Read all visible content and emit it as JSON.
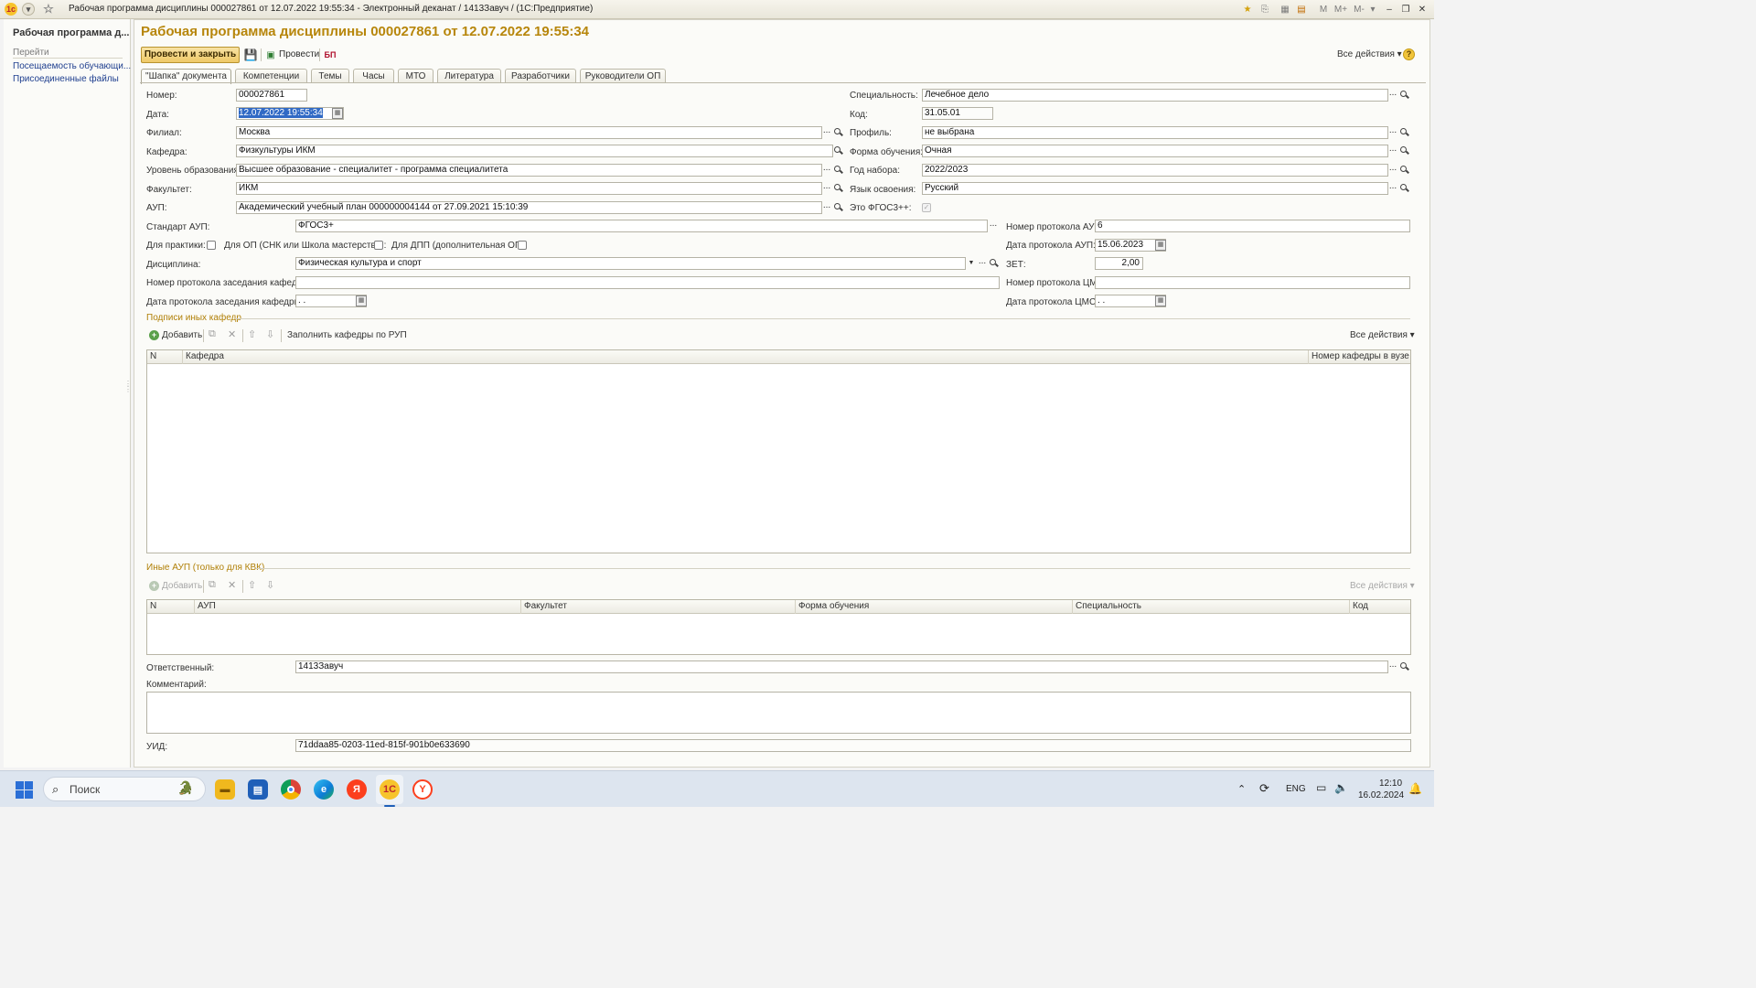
{
  "window": {
    "title": "Рабочая программа дисциплины 000027861 от 12.07.2022 19:55:34 - Электронный деканат / 1413Завуч /   (1С:Предприятие)",
    "tr_m": "M",
    "tr_mplus": "M+",
    "tr_mminus": "M-"
  },
  "left_panel": {
    "title": "Рабочая программа д...",
    "section": "Перейти",
    "links": [
      "Посещаемость обучающи...",
      "Присоединенные файлы"
    ]
  },
  "doc": {
    "title": "Рабочая программа дисциплины 000027861 от 12.07.2022 19:55:34",
    "toolbar": {
      "post_close": "Провести и закрыть",
      "post": "Провести",
      "bp_icon": "БП",
      "all_actions": "Все действия"
    },
    "tabs": [
      "\"Шапка\" документа",
      "Компетенции",
      "Темы",
      "Часы",
      "МТО",
      "Литература",
      "Разработчики",
      "Руководители ОП"
    ]
  },
  "form": {
    "number": {
      "label": "Номер:",
      "value": "000027861"
    },
    "date": {
      "label": "Дата:",
      "value": "12.07.2022 19:55:34"
    },
    "branch": {
      "label": "Филиал:",
      "value": "Москва"
    },
    "department": {
      "label": "Кафедра:",
      "value": "Физкультуры ИКМ"
    },
    "edu_level": {
      "label": "Уровень образования:",
      "value": "Высшее образование - специалитет - программа специалитета"
    },
    "faculty": {
      "label": "Факультет:",
      "value": "ИКМ"
    },
    "aup": {
      "label": "АУП:",
      "value": "Академический учебный план 000000004144 от 27.09.2021 15:10:39"
    },
    "specialty": {
      "label": "Специальность:",
      "value": "Лечебное дело"
    },
    "code": {
      "label": "Код:",
      "value": "31.05.01"
    },
    "profile": {
      "label": "Профиль:",
      "value": "не выбрана"
    },
    "study_form": {
      "label": "Форма обучения:",
      "value": "Очная"
    },
    "enroll_year": {
      "label": "Год набора:",
      "value": "2022/2023"
    },
    "language": {
      "label": "Язык освоения:",
      "value": "Русский"
    },
    "fgos": {
      "label": "Это ФГОС3++:"
    },
    "aup_standard": {
      "label": "Стандарт АУП:",
      "value": "ФГОС3+"
    },
    "aup_protocol_num": {
      "label": "Номер протокола АУП:",
      "value": "6"
    },
    "for_practice": {
      "label": "Для практики:"
    },
    "for_op": {
      "label": "Для ОП (СНК или Школа мастерства):"
    },
    "for_dpp": {
      "label": "Для ДПП (дополнительная ОП):"
    },
    "aup_protocol_date": {
      "label": "Дата протокола АУП:",
      "value": "15.06.2023"
    },
    "discipline": {
      "label": "Дисциплина:",
      "value": "Физическая культура и спорт"
    },
    "zet": {
      "label": "ЗЕТ:",
      "value": "2,00"
    },
    "dept_protocol_num": {
      "label": "Номер протокола заседания кафедры:",
      "value": ""
    },
    "cms_protocol_num": {
      "label": "Номер протокола ЦМС:",
      "value": ""
    },
    "dept_protocol_date": {
      "label": "Дата протокола заседания кафедры:",
      "value": " .  ."
    },
    "cms_protocol_date": {
      "label": "Дата протокола ЦМС:",
      "value": " .  ."
    },
    "responsible": {
      "label": "Ответственный:",
      "value": "1413Завуч"
    },
    "comment": {
      "label": "Комментарий:",
      "value": ""
    },
    "uid": {
      "label": "УИД:",
      "value": "71ddaa85-0203-11ed-815f-901b0e633690"
    }
  },
  "signatures": {
    "group_label": "Подписи иных кафедр",
    "add": "Добавить",
    "fill": "Заполнить кафедры по РУП",
    "all_actions": "Все действия",
    "columns": [
      "N",
      "Кафедра",
      "Номер кафедры в вузе"
    ]
  },
  "other_aup": {
    "group_label": "Иные АУП (только для КВК)",
    "add": "Добавить",
    "all_actions": "Все действия",
    "columns": [
      "N",
      "АУП",
      "Факультет",
      "Форма обучения",
      "Специальность",
      "Код"
    ]
  },
  "taskbar": {
    "search_placeholder": "Поиск",
    "lang": "ENG",
    "time": "12:10",
    "date": "16.02.2024",
    "app_1c": "1С",
    "app_yandex": "Я",
    "app_ybrowser": "Y"
  },
  "colors": {
    "accent": "#b7860b",
    "primary_button": "#efc967",
    "link": "#1f3f8f"
  }
}
